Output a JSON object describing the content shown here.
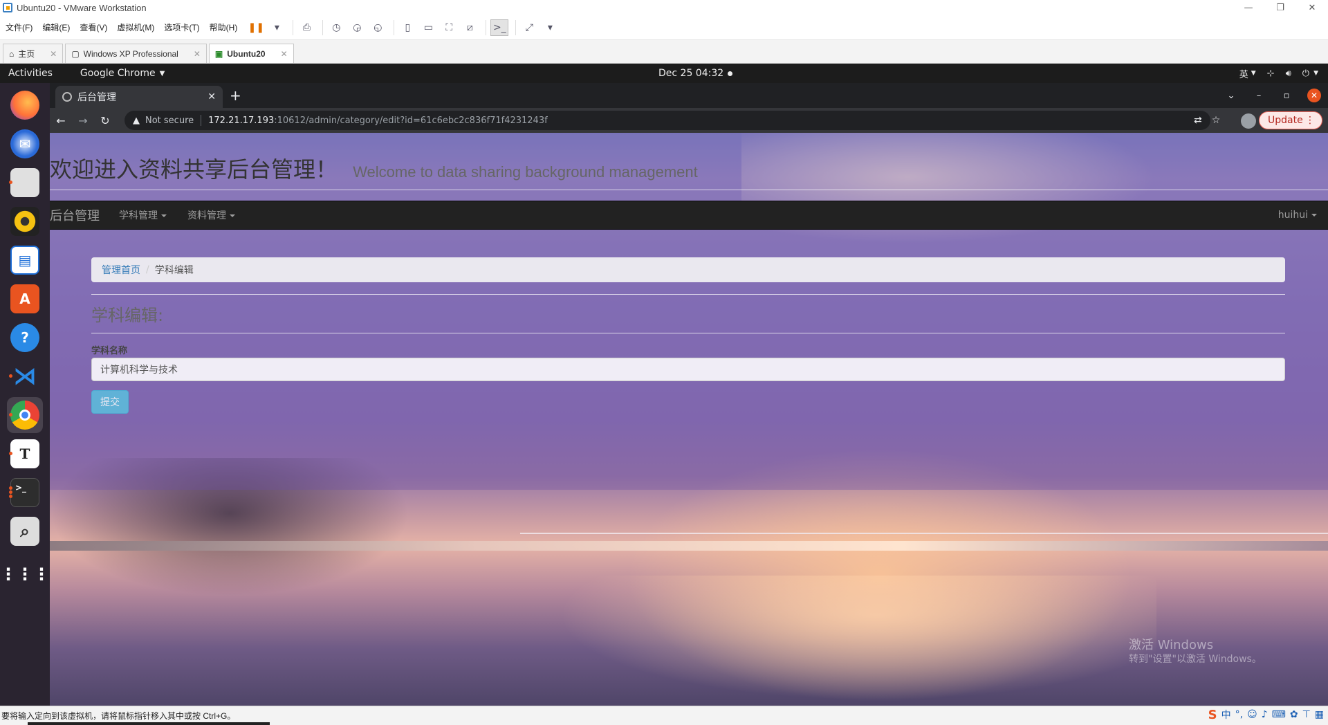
{
  "vm": {
    "title": "Ubuntu20 - VMware Workstation",
    "menus": [
      "文件(F)",
      "编辑(E)",
      "查看(V)",
      "虚拟机(M)",
      "选项卡(T)",
      "帮助(H)"
    ],
    "tabs": [
      {
        "label": "主页",
        "active": false
      },
      {
        "label": "Windows XP Professional",
        "active": false
      },
      {
        "label": "Ubuntu20",
        "active": true
      }
    ],
    "status": "要将输入定向到该虚拟机，请将鼠标指针移入其中或按 Ctrl+G。"
  },
  "ubuntu": {
    "activities": "Activities",
    "app": "Google Chrome",
    "clock": "Dec 25  04:32",
    "ime": "英"
  },
  "chrome": {
    "tab_title": "后台管理",
    "not_secure": "Not secure",
    "url_host": "172.21.17.193",
    "url_path": ":10612/admin/category/edit?id=61c6ebc2c836f71f4231243f",
    "update": "Update"
  },
  "site": {
    "title": "欢迎进入资料共享后台管理！",
    "subtitle": "Welcome to data sharing background management",
    "brand": "后台管理",
    "nav": [
      "学科管理",
      "资料管理"
    ],
    "user": "huihui",
    "breadcrumb": {
      "home": "管理首页",
      "current": "学科编辑"
    },
    "heading": "学科编辑:",
    "field_label": "学科名称",
    "field_value": "计算机科学与技术",
    "submit": "提交"
  },
  "watermark": {
    "line1": "激活 Windows",
    "line2": "转到\"设置\"以激活 Windows。"
  },
  "ime_bar": {
    "lang": "中"
  }
}
